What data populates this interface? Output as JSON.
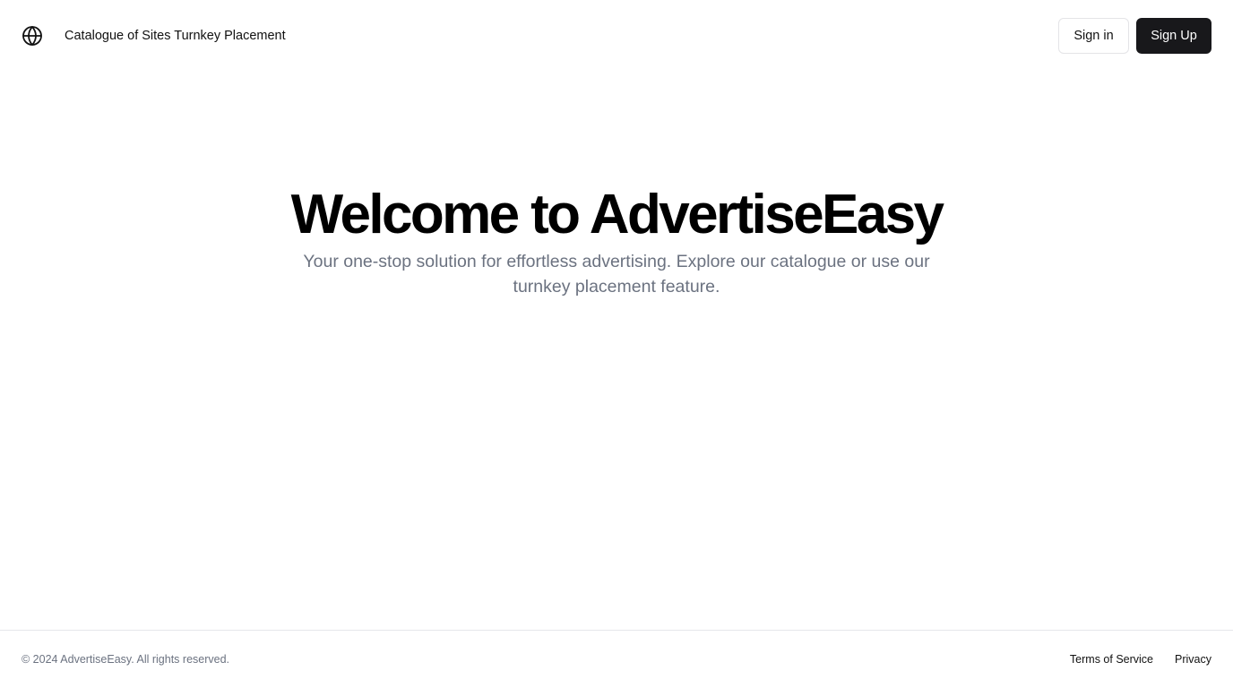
{
  "header": {
    "logo_icon": "globe-icon",
    "nav_link": "Catalogue of Sites Turnkey Placement",
    "signin_label": "Sign in",
    "signup_label": "Sign Up"
  },
  "hero": {
    "title": "Welcome to AdvertiseEasy",
    "subtitle": "Your one-stop solution for effortless advertising. Explore our catalogue or use our turnkey placement feature."
  },
  "footer": {
    "copyright": "© 2024 AdvertiseEasy. All rights reserved.",
    "links": [
      "Terms of Service",
      "Privacy"
    ]
  },
  "colors": {
    "primary_button": "#18181b",
    "subtitle_text": "#6b7280",
    "border": "#e5e7eb"
  }
}
